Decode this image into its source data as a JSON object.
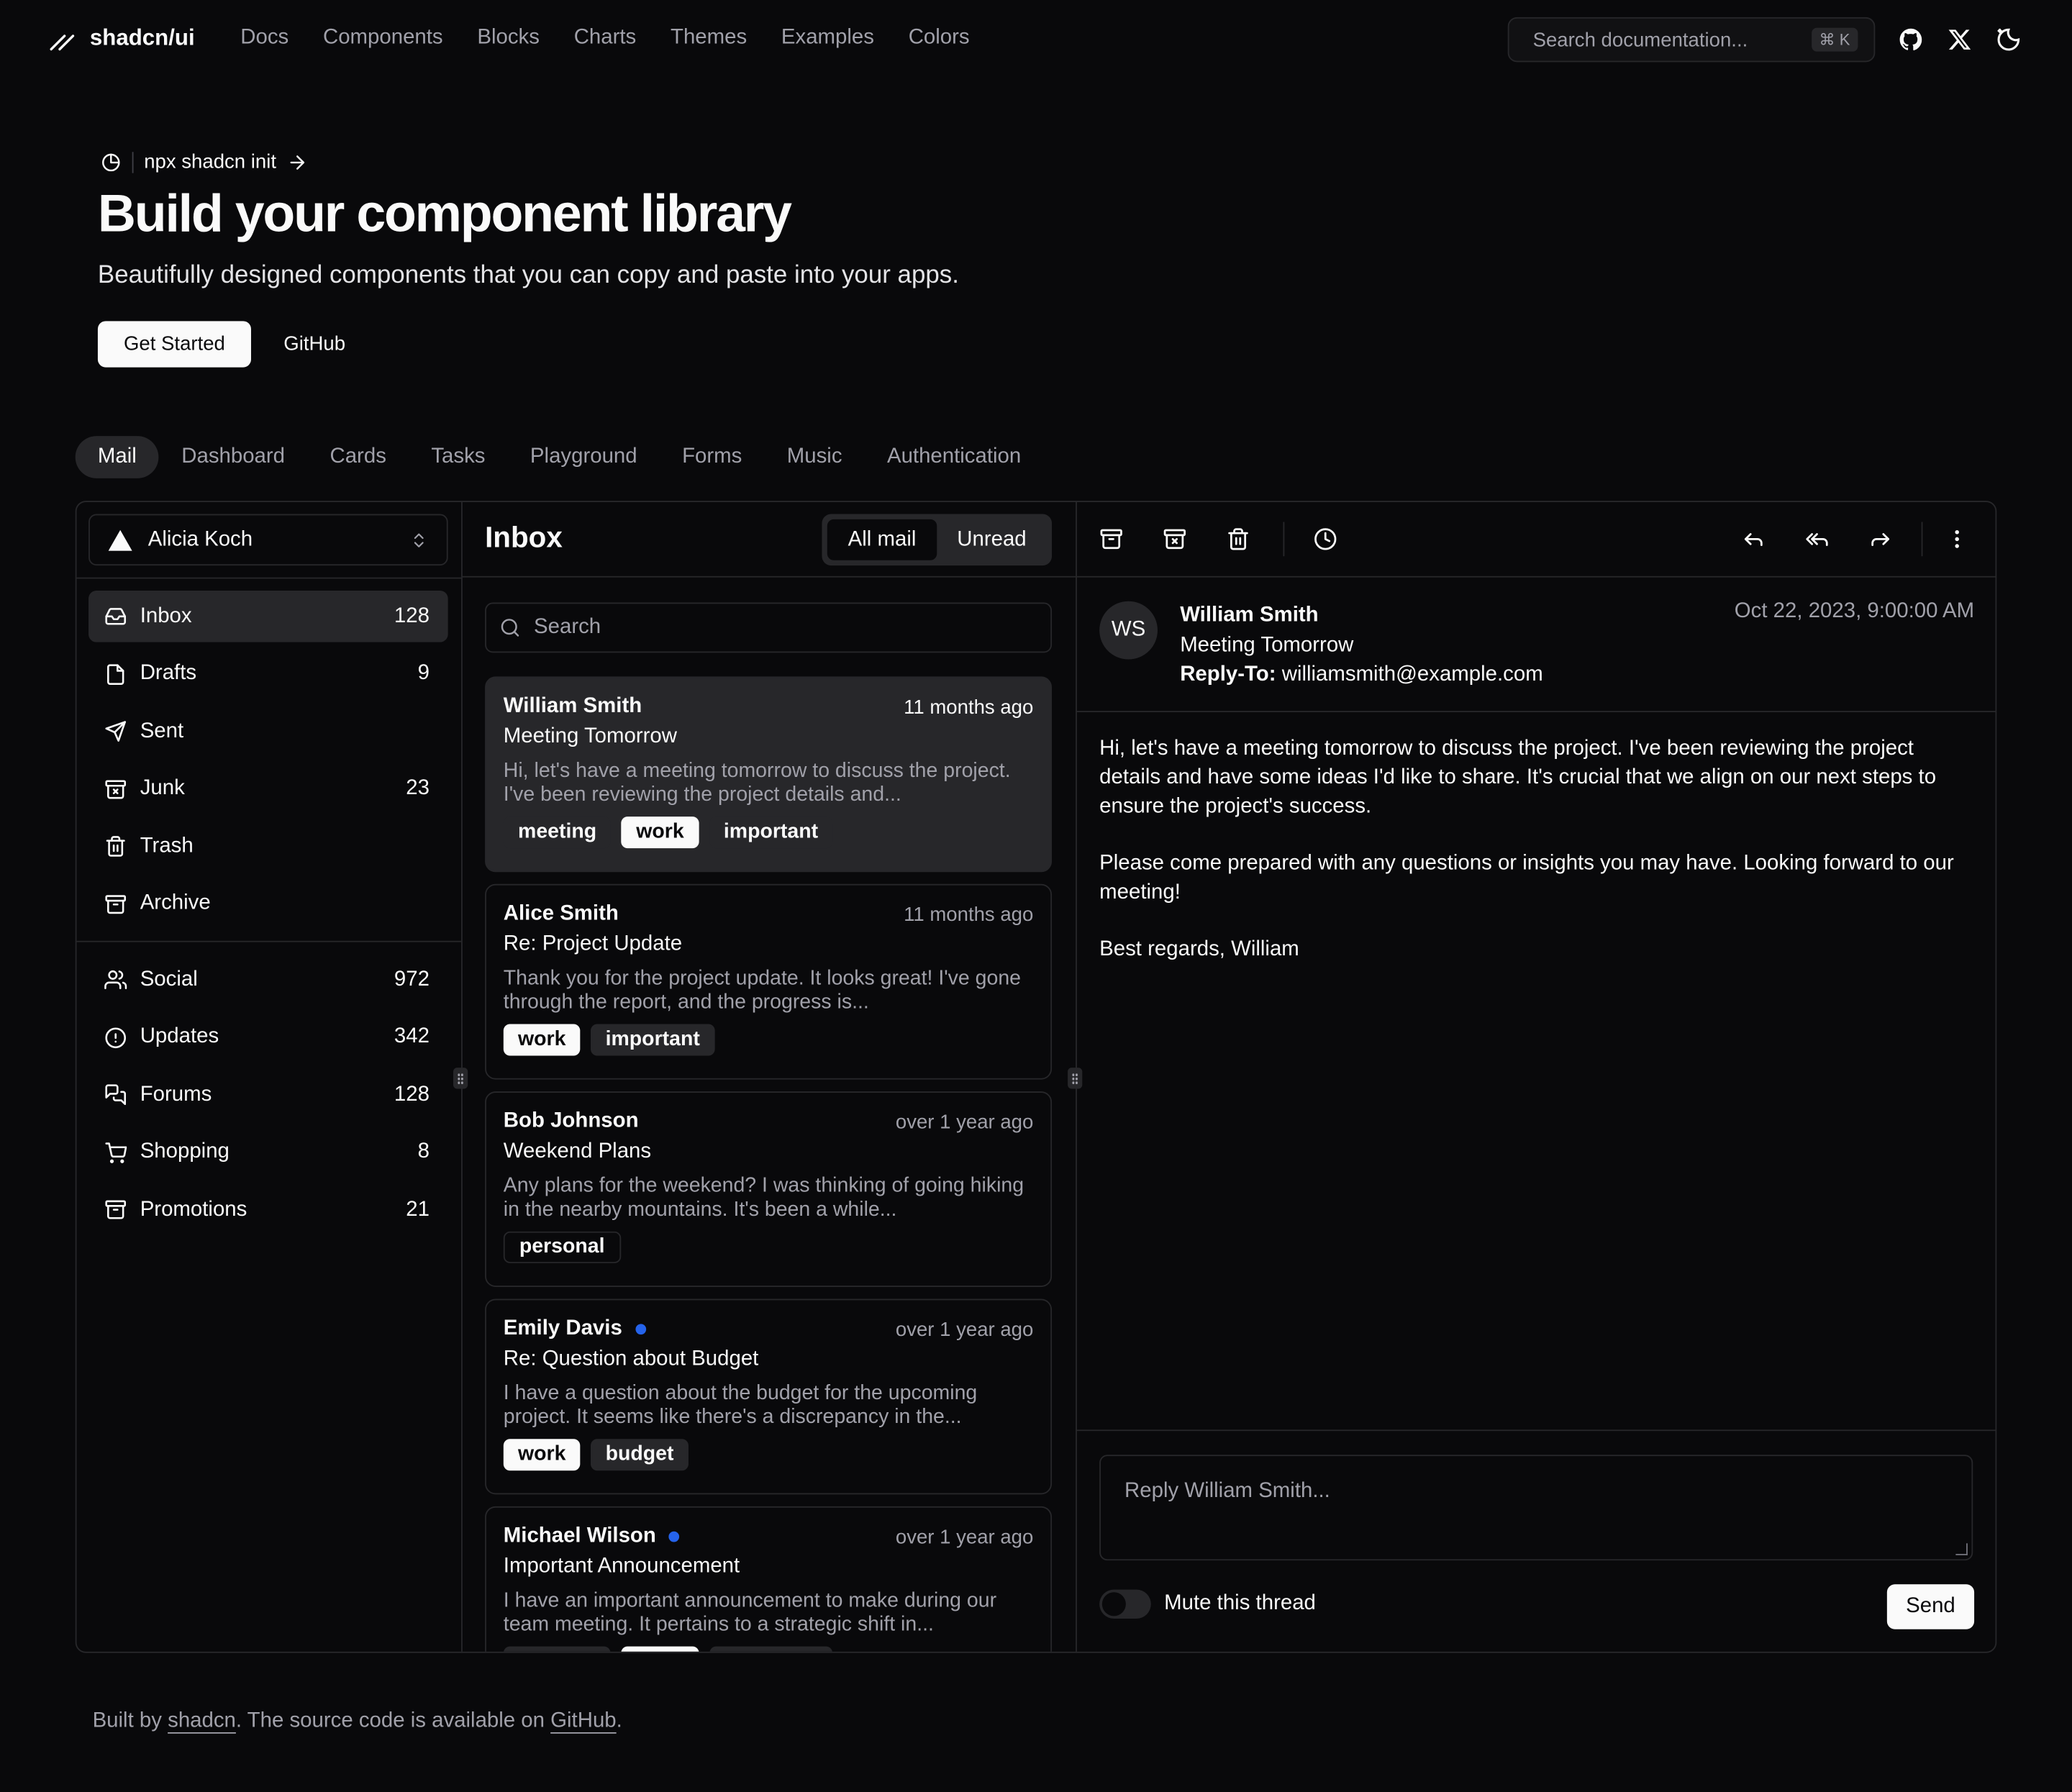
{
  "header": {
    "brand": "shadcn/ui",
    "nav": [
      "Docs",
      "Components",
      "Blocks",
      "Charts",
      "Themes",
      "Examples",
      "Colors"
    ],
    "search_placeholder": "Search documentation...",
    "search_kbd": "⌘ K",
    "icons": [
      "github-icon",
      "x-logo-icon",
      "theme-toggle-icon"
    ]
  },
  "hero": {
    "announcement": "npx shadcn init",
    "title": "Build your component library",
    "subtitle": "Beautifully designed components that you can copy and paste into your apps.",
    "primary_button": "Get Started",
    "secondary_button": "GitHub"
  },
  "example_tabs": [
    "Mail",
    "Dashboard",
    "Cards",
    "Tasks",
    "Playground",
    "Forms",
    "Music",
    "Authentication"
  ],
  "mail": {
    "account": "Alicia Koch",
    "nav_primary": [
      {
        "label": "Inbox",
        "count": "128",
        "icon": "inbox-icon",
        "active": true
      },
      {
        "label": "Drafts",
        "count": "9",
        "icon": "file-icon"
      },
      {
        "label": "Sent",
        "count": "",
        "icon": "send-icon"
      },
      {
        "label": "Junk",
        "count": "23",
        "icon": "archive-x-icon"
      },
      {
        "label": "Trash",
        "count": "",
        "icon": "trash-icon"
      },
      {
        "label": "Archive",
        "count": "",
        "icon": "archive-icon"
      }
    ],
    "nav_secondary": [
      {
        "label": "Social",
        "count": "972",
        "icon": "users-icon"
      },
      {
        "label": "Updates",
        "count": "342",
        "icon": "alert-circle-icon"
      },
      {
        "label": "Forums",
        "count": "128",
        "icon": "messages-icon"
      },
      {
        "label": "Shopping",
        "count": "8",
        "icon": "cart-icon"
      },
      {
        "label": "Promotions",
        "count": "21",
        "icon": "archive-icon"
      }
    ],
    "inbox_title": "Inbox",
    "filter": {
      "all": "All mail",
      "unread": "Unread"
    },
    "search_placeholder": "Search",
    "messages": [
      {
        "name": "William Smith",
        "unread": false,
        "time": "11 months ago",
        "subject": "Meeting Tomorrow",
        "preview": "Hi, let's have a meeting tomorrow to discuss the project. I've been reviewing the project details and...",
        "tags": [
          "meeting",
          "work",
          "important"
        ]
      },
      {
        "name": "Alice Smith",
        "unread": false,
        "time": "11 months ago",
        "subject": "Re: Project Update",
        "preview": "Thank you for the project update. It looks great! I've gone through the report, and the progress is...",
        "tags": [
          "work",
          "important"
        ]
      },
      {
        "name": "Bob Johnson",
        "unread": false,
        "time": "over 1 year ago",
        "subject": "Weekend Plans",
        "preview": "Any plans for the weekend? I was thinking of going hiking in the nearby mountains. It's been a while...",
        "tags": [
          "personal"
        ]
      },
      {
        "name": "Emily Davis",
        "unread": true,
        "time": "over 1 year ago",
        "subject": "Re: Question about Budget",
        "preview": "I have a question about the budget for the upcoming project. It seems like there's a discrepancy in the...",
        "tags": [
          "work",
          "budget"
        ]
      },
      {
        "name": "Michael Wilson",
        "unread": true,
        "time": "over 1 year ago",
        "subject": "Important Announcement",
        "preview": "I have an important announcement to make during our team meeting. It pertains to a strategic shift in...",
        "tags": [
          "meeting",
          "work",
          "important"
        ]
      }
    ],
    "detail": {
      "initials": "WS",
      "name": "William Smith",
      "subject": "Meeting Tomorrow",
      "reply_to_label": "Reply-To:",
      "reply_to": "williamsmith@example.com",
      "date": "Oct 22, 2023, 9:00:00 AM",
      "body": [
        "Hi, let's have a meeting tomorrow to discuss the project. I've been reviewing the project details and have some ideas I'd like to share. It's crucial that we align on our next steps to ensure the project's success.",
        "Please come prepared with any questions or insights you may have. Looking forward to our meeting!",
        "Best regards, William"
      ],
      "reply_placeholder": "Reply William Smith...",
      "mute_label": "Mute this thread",
      "send_label": "Send"
    }
  },
  "footer": {
    "prefix": "Built by ",
    "author": "shadcn",
    "middle": ". The source code is available on ",
    "repo": "GitHub",
    "suffix": "."
  },
  "colors": {
    "background": "#09090b",
    "border": "#27272a",
    "muted": "#a1a1aa",
    "foreground": "#fafafa",
    "unread_dot": "#2563eb"
  }
}
